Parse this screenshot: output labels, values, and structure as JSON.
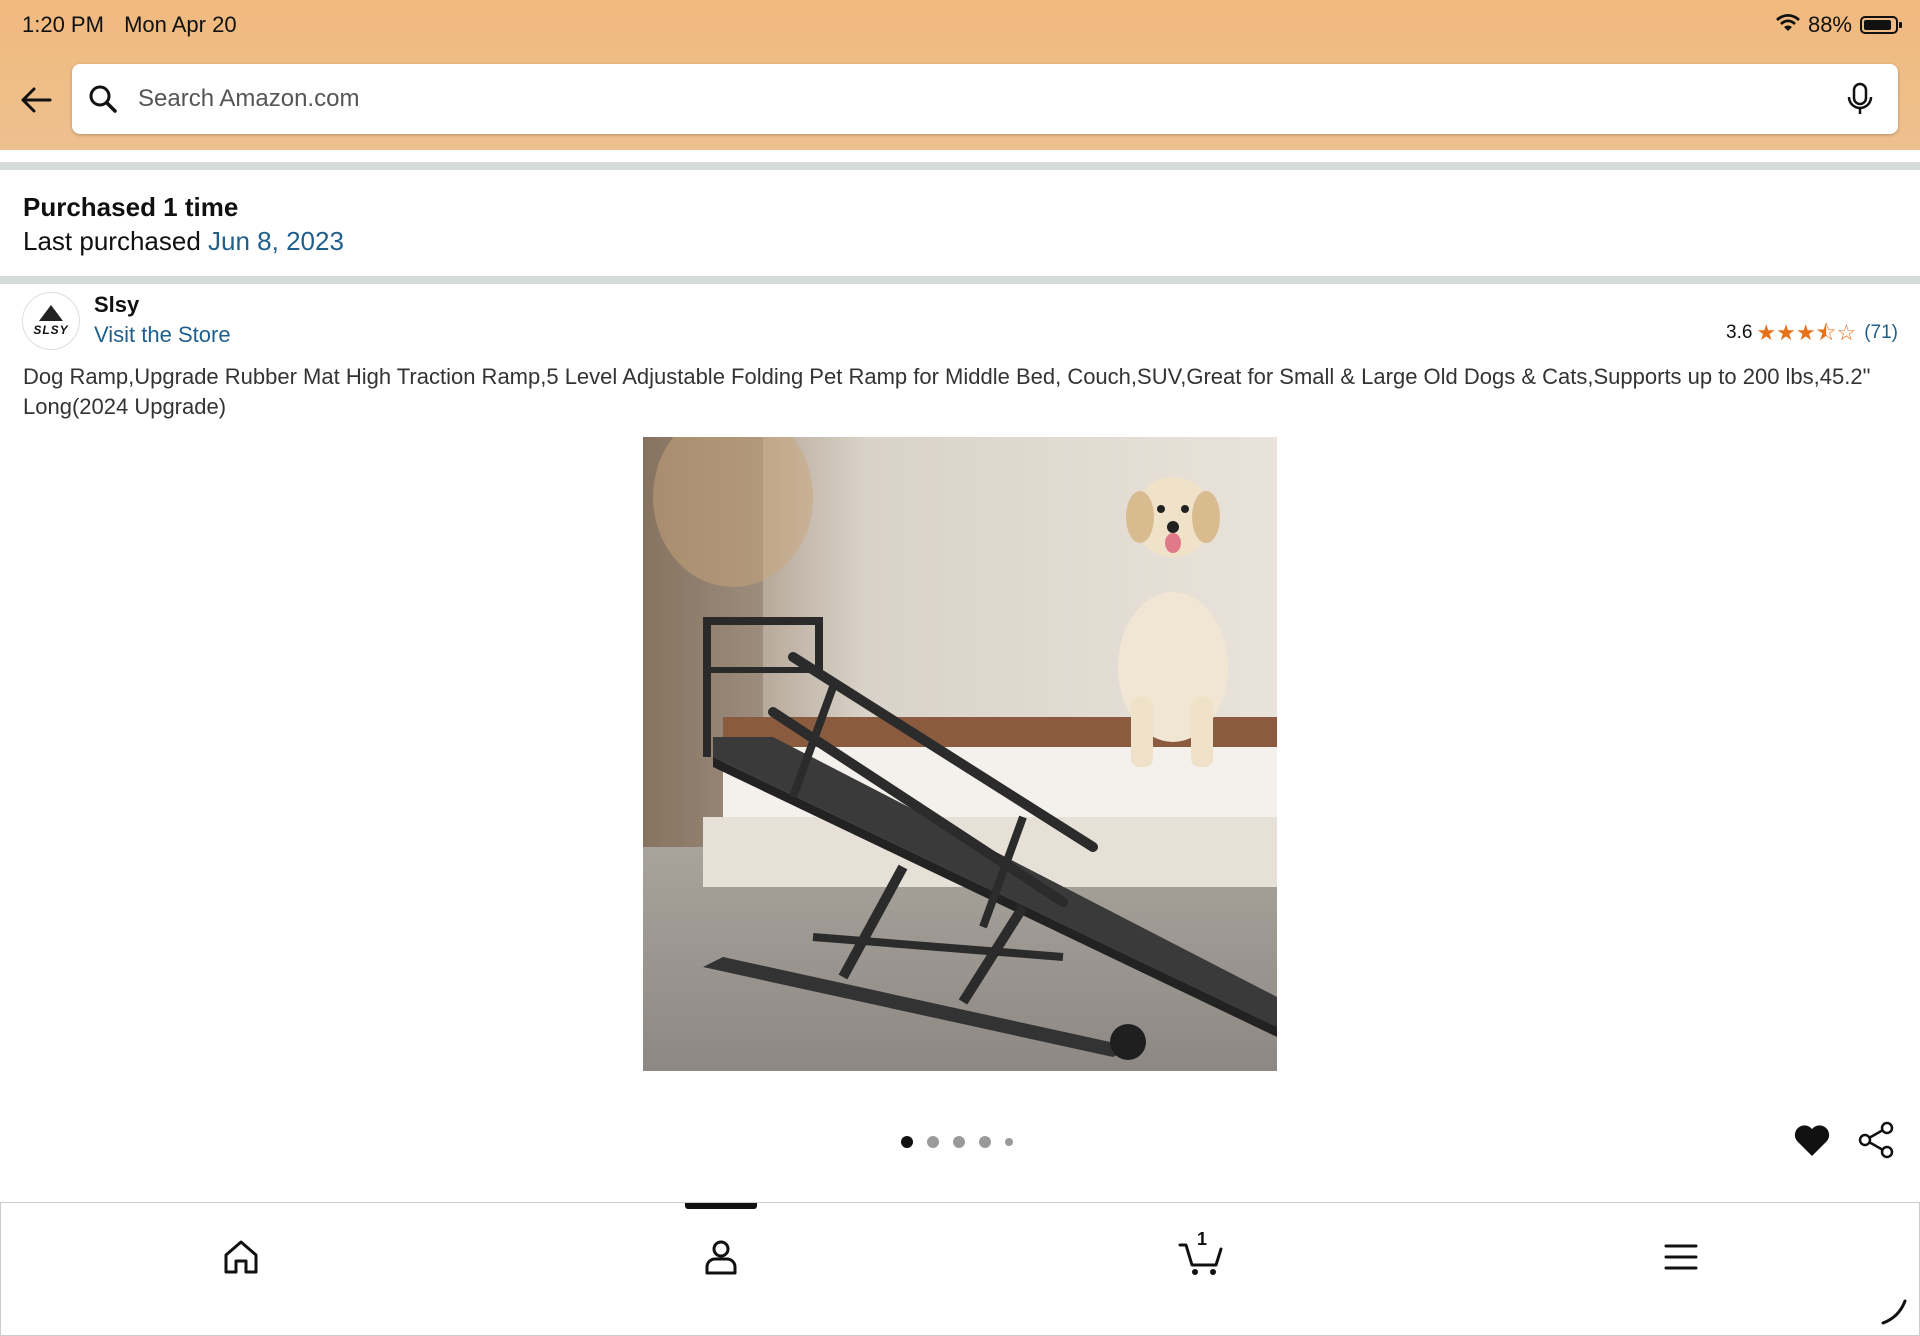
{
  "status_bar": {
    "time": "1:20 PM",
    "date": "Mon Apr 20",
    "battery": "88%"
  },
  "search": {
    "placeholder": "Search Amazon.com"
  },
  "purchase": {
    "count_text": "Purchased 1 time",
    "last_label": "Last purchased",
    "last_date": "Jun 8, 2023"
  },
  "brand": {
    "logo_text": "SLSY",
    "name": "Slsy",
    "store_link": "Visit the Store"
  },
  "rating": {
    "value": "3.6",
    "stars": 3.6,
    "count": "(71)"
  },
  "product": {
    "title": "Dog Ramp,Upgrade Rubber Mat High Traction Ramp,5 Level Adjustable Folding Pet Ramp for Middle Bed, Couch,SUV,Great for Small & Large Old Dogs & Cats,Supports up to 200 lbs,45.2\" Long(2024 Upgrade)"
  },
  "carousel": {
    "total": 5,
    "active_index": 0
  },
  "bottom_nav": {
    "items": [
      "home-icon",
      "account-icon",
      "cart-icon",
      "menu-icon"
    ],
    "active": "account",
    "cart_count": "1"
  },
  "colors": {
    "topbar": "#f0b97e",
    "link": "#1f5f8b",
    "star": "#e7711b",
    "divider": "#d5dbdb"
  }
}
